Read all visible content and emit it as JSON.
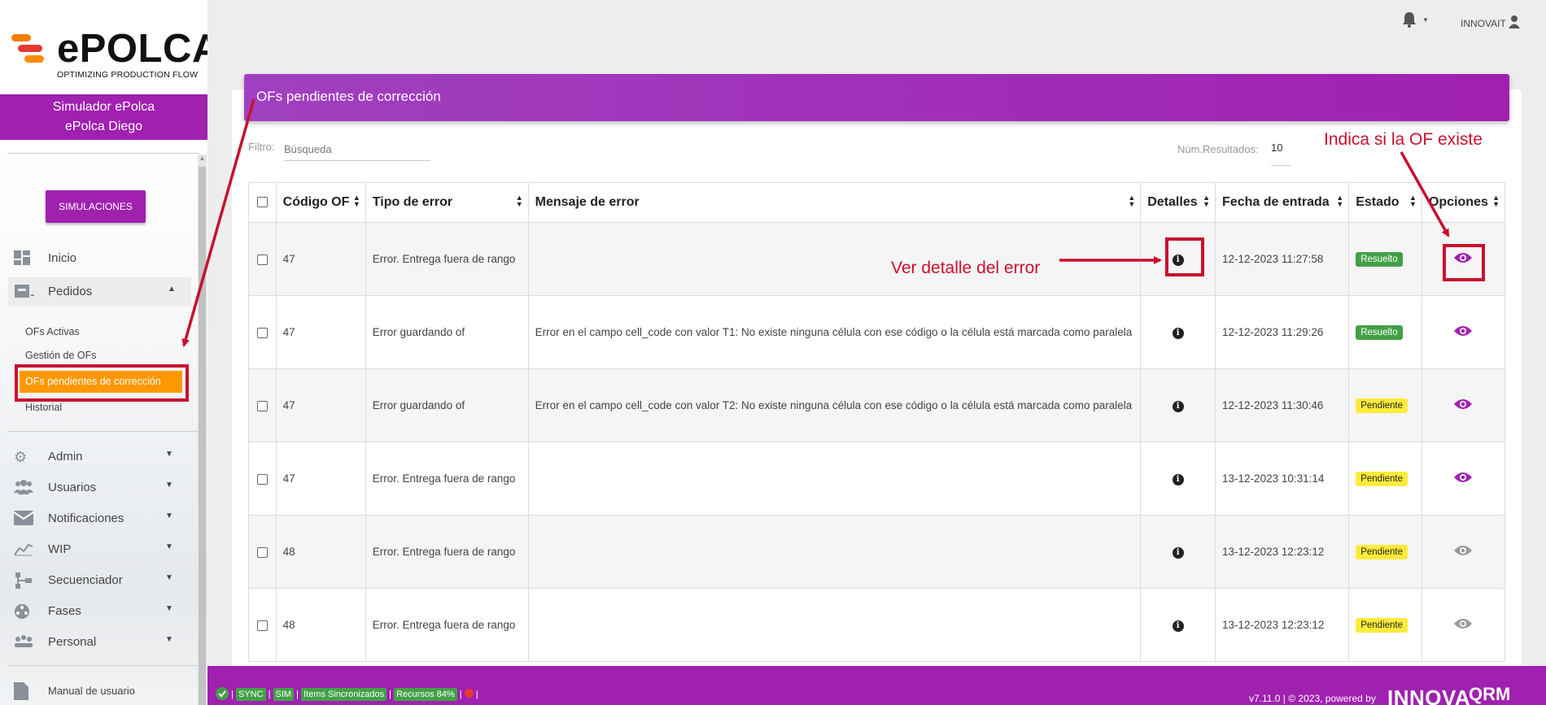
{
  "brand": {
    "name": "ePOLCA",
    "tagline": "OPTIMIZING PRODUCTION FLOW"
  },
  "sidebar": {
    "sim_title": "Simulador ePolca",
    "sim_name": "ePolca Diego",
    "sim_button": "SIMULACIONES",
    "items": [
      {
        "label": "Inicio",
        "icon": "dashboard-icon"
      },
      {
        "label": "Pedidos",
        "icon": "archive-icon"
      },
      {
        "label": "Admin",
        "icon": "gears-icon"
      },
      {
        "label": "Usuarios",
        "icon": "users-icon"
      },
      {
        "label": "Notificaciones",
        "icon": "envelope-icon"
      },
      {
        "label": "WIP",
        "icon": "chart-line-icon"
      },
      {
        "label": "Secuenciador",
        "icon": "sitemap-icon"
      },
      {
        "label": "Fases",
        "icon": "circle-dots-icon"
      },
      {
        "label": "Personal",
        "icon": "people-icon"
      },
      {
        "label": "Manual de usuario",
        "icon": "file-icon"
      }
    ],
    "subitems": [
      "OFs Activas",
      "Gestión de OFs",
      "OFs pendientes de corrección",
      "Historial"
    ]
  },
  "topbar": {
    "user": "INNOVAIT"
  },
  "panel": {
    "title": "OFs pendientes de corrección",
    "filter_label": "Filtro:",
    "filter_placeholder": "Búsqueda",
    "results_label": "Núm.Resultados:",
    "results_value": "10"
  },
  "table": {
    "headers": [
      "Código OF",
      "Tipo de error",
      "Mensaje de error",
      "Detalles",
      "Fecha de entrada",
      "Estado",
      "Opciones"
    ],
    "rows": [
      {
        "code": "47",
        "type": "Error. Entrega fuera de rango",
        "message": "",
        "date": "12-12-2023 11:27:58",
        "status": "Resuelto",
        "eye_active": true
      },
      {
        "code": "47",
        "type": "Error guardando of",
        "message": "Error en el campo cell_code con valor T1: No existe ninguna célula con ese código o la célula está marcada como paralela",
        "date": "12-12-2023 11:29:26",
        "status": "Resuelto",
        "eye_active": true
      },
      {
        "code": "47",
        "type": "Error guardando of",
        "message": "Error en el campo cell_code con valor T2: No existe ninguna célula con ese código o la célula está marcada como paralela",
        "date": "12-12-2023 11:30:46",
        "status": "Pendiente",
        "eye_active": true
      },
      {
        "code": "47",
        "type": "Error. Entrega fuera de rango",
        "message": "",
        "date": "13-12-2023 10:31:14",
        "status": "Pendiente",
        "eye_active": true
      },
      {
        "code": "48",
        "type": "Error. Entrega fuera de rango",
        "message": "",
        "date": "13-12-2023 12:23:12",
        "status": "Pendiente",
        "eye_active": false
      },
      {
        "code": "48",
        "type": "Error. Entrega fuera de rango",
        "message": "",
        "date": "13-12-2023 12:23:12",
        "status": "Pendiente",
        "eye_active": false
      }
    ]
  },
  "annotations": {
    "detail": "Ver detalle del error",
    "exists": "Indica si la OF existe"
  },
  "footer": {
    "sync": "SYNC",
    "sim": "SIM",
    "items": "Items Sincronizados",
    "resources": "Recursos 84%",
    "version": "v7.11.0 | © 2023, powered by",
    "logo1": "INNOVA",
    "logo2": "QRM"
  },
  "colors": {
    "accent": "#a020b0",
    "active": "#ff9800",
    "annotation": "#c8102e",
    "resolved": "#43a047",
    "pending": "#ffeb3b"
  }
}
